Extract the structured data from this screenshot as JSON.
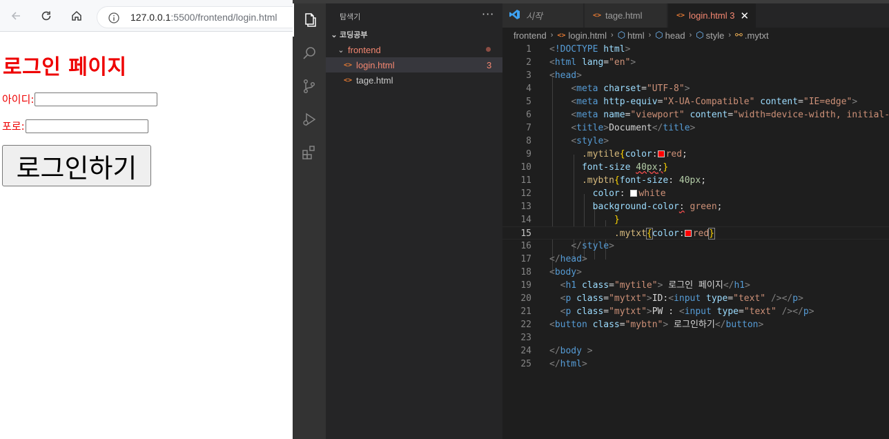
{
  "browser": {
    "url_host": "127.0.0.1",
    "url_rest": ":5500/frontend/login.html",
    "page": {
      "title": "로그인 페이지",
      "id_label": "아이디:",
      "pw_label": "포로: ",
      "button_label": "로그인하기"
    }
  },
  "vscode": {
    "explorer": {
      "title": "탐색기",
      "more": "···",
      "root_folder": "코딩공부",
      "folder": "frontend",
      "files": [
        {
          "name": "login.html",
          "badge": "3",
          "active": true
        },
        {
          "name": "tage.html",
          "badge": "",
          "active": false
        }
      ]
    },
    "tabs": [
      {
        "label": "시작",
        "icon": "vscode-logo-icon"
      },
      {
        "label": "tage.html",
        "icon": "html-icon"
      },
      {
        "label": "login.html 3",
        "icon": "html-icon",
        "active": true
      }
    ],
    "breadcrumb": [
      "frontend",
      "login.html",
      "html",
      "head",
      "style",
      ".mytxt"
    ],
    "current_line": 15,
    "line_count": 25,
    "colors": {
      "error": "#f48771",
      "swatch_red": "#ff0000",
      "swatch_white": "#ffffff"
    }
  }
}
